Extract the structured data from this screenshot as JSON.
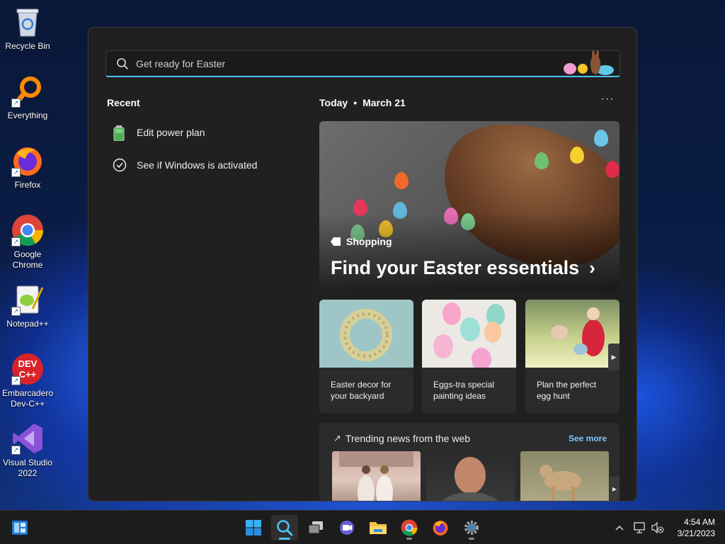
{
  "desktop": {
    "icons": [
      {
        "label": "Recycle Bin",
        "icon": "recycle-bin-icon"
      },
      {
        "label": "Everything",
        "icon": "everything-search-icon"
      },
      {
        "label": "Firefox",
        "icon": "firefox-icon"
      },
      {
        "label": "Google Chrome",
        "icon": "chrome-icon"
      },
      {
        "label": "Notepad++",
        "icon": "notepad-plus-plus-icon"
      },
      {
        "label": "Embarcadero Dev-C++",
        "icon": "dev-cpp-icon"
      },
      {
        "label": "Visual Studio 2022",
        "icon": "visual-studio-icon"
      }
    ]
  },
  "search": {
    "placeholder": "Get ready for Easter"
  },
  "recent": {
    "title": "Recent",
    "items": [
      {
        "label": "Edit power plan",
        "icon": "battery-icon"
      },
      {
        "label": "See if Windows is activated",
        "icon": "check-circle-icon"
      }
    ]
  },
  "today": {
    "label": "Today",
    "date": "March 21",
    "more": "···"
  },
  "hero": {
    "tag": "Shopping",
    "headline": "Find your Easter essentials",
    "chevron": "›"
  },
  "cards": [
    {
      "caption": "Easter decor for your backyard"
    },
    {
      "caption": "Eggs-tra special painting ideas"
    },
    {
      "caption": "Plan the perfect egg hunt"
    }
  ],
  "trending": {
    "title": "Trending news from the web",
    "see_more": "See more"
  },
  "taskbar": {
    "apps": [
      "widgets-icon",
      "start-icon",
      "search-icon",
      "task-view-icon",
      "teams-chat-icon",
      "file-explorer-icon",
      "chrome-icon",
      "firefox-icon",
      "settings-icon"
    ]
  },
  "clock": {
    "time": "4:54 AM",
    "date": "3/21/2023"
  },
  "colors": {
    "accent": "#4cc2ff",
    "panel": "#202020",
    "card": "#2b2b2b",
    "taskbar": "#1c1c1c"
  }
}
